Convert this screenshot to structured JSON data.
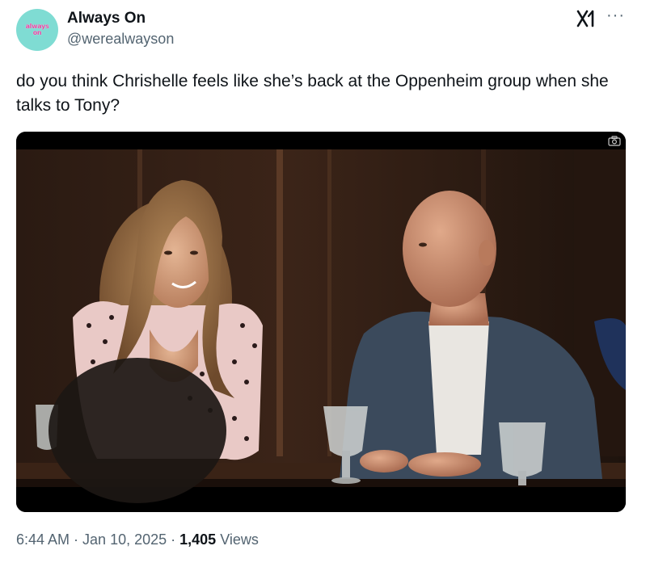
{
  "author": {
    "avatar_text_line1": "always",
    "avatar_text_line2": "on",
    "display_name": "Always On",
    "handle": "@werealwayson"
  },
  "tweet": {
    "text": "do you think Chrishelle feels like she’s back at the Oppenheim group when she talks to Tony?"
  },
  "meta": {
    "time": "6:44 AM",
    "separator1": " · ",
    "date": "Jan 10, 2025",
    "separator2": " · ",
    "views_count": "1,405",
    "views_label": " Views"
  },
  "icons": {
    "grok": "grok-icon",
    "more": "more-options-icon",
    "camera": "camera-icon"
  },
  "colors": {
    "avatar_bg": "#7fdcd3",
    "avatar_text": "#e84aa6",
    "secondary_text": "#536471",
    "primary_text": "#0f1419"
  }
}
